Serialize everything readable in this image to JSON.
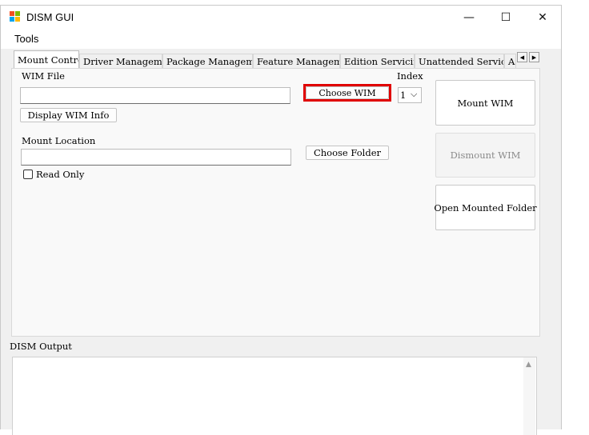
{
  "window": {
    "title": "DISM GUI",
    "controls": {
      "minimize": "—",
      "maximize": "☐",
      "close": "✕"
    }
  },
  "menu": {
    "items": [
      "Tools"
    ]
  },
  "tabs": [
    {
      "label": "Mount Control",
      "active": true
    },
    {
      "label": "Driver Management"
    },
    {
      "label": "Package Management"
    },
    {
      "label": "Feature Management"
    },
    {
      "label": "Edition Servicing"
    },
    {
      "label": "Unattended Servicing"
    },
    {
      "label": "A"
    }
  ],
  "tab_scroll": {
    "left": "◀",
    "right": "▶"
  },
  "mount_control": {
    "wim_file_label": "WIM File",
    "wim_file_value": "",
    "choose_wim": "Choose WIM",
    "index_label": "Index",
    "index_value": "1",
    "index_arrow": "⌵",
    "display_wim_info": "Display WIM Info",
    "mount_location_label": "Mount Location",
    "mount_location_value": "",
    "choose_folder": "Choose Folder",
    "read_only": "Read Only",
    "read_only_checked": false,
    "mount_wim": "Mount WIM",
    "dismount_wim": "Dismount WIM",
    "open_mounted_folder": "Open Mounted Folder"
  },
  "output": {
    "label": "DISM Output",
    "scroll_up": "▲",
    "value": ""
  },
  "colors": {
    "highlight": "#e00000",
    "panel": "#f9f9f9",
    "window": "#f0f0f0"
  }
}
